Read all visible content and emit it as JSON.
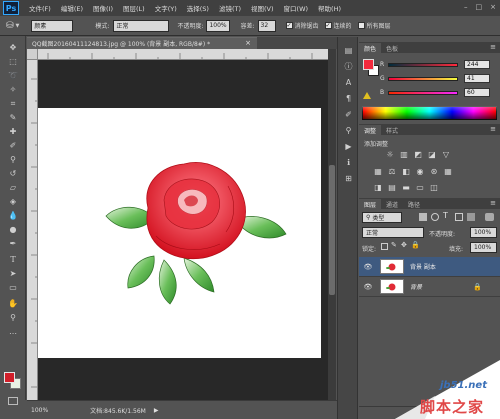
{
  "app": {
    "logo": "Ps"
  },
  "menubar": {
    "items": [
      "文件(F)",
      "编辑(E)",
      "图像(I)",
      "图层(L)",
      "文字(Y)",
      "选择(S)",
      "滤镜(T)",
      "视图(V)",
      "窗口(W)",
      "帮助(H)"
    ],
    "window_controls": [
      "–",
      "□",
      "×"
    ]
  },
  "options": {
    "brush_mode_label": "模式:",
    "preset_value": "颜素",
    "mode_value": "正常",
    "opacity_label": "不透明度:",
    "opacity_value": "100%",
    "tolerance_label": "容差:",
    "tolerance_value": "32",
    "antialias_label": "消除锯齿",
    "contiguous_label": "连续的",
    "all_layers_label": "所有图层"
  },
  "document": {
    "tab_title": "QQ截图20160411124813.jpg @ 100% (背景 副本, RGB/8#) *",
    "close_glyph": "×"
  },
  "status": {
    "zoom": "100%",
    "doc_size": "文档:845.6K/1.56M"
  },
  "color_panel": {
    "tabs": [
      "颜色",
      "色板"
    ],
    "r_label": "R",
    "r_value": "244",
    "g_label": "G",
    "g_value": "41",
    "b_label": "B",
    "b_value": "60",
    "foreground": "#f4293c",
    "background": "#ffffff"
  },
  "adjustments_panel": {
    "tabs": [
      "调整",
      "样式"
    ],
    "title": "添加调整"
  },
  "layers_panel": {
    "tabs": [
      "图层",
      "通道",
      "路径"
    ],
    "kind_filter": "类型",
    "blend_mode": "正常",
    "opacity_label": "不透明度:",
    "opacity_value": "100%",
    "lock_label": "锁定:",
    "fill_label": "填充:",
    "fill_value": "100%",
    "layers": [
      {
        "name": "背景 副本",
        "selected": true
      },
      {
        "name": "背景",
        "selected": false
      }
    ]
  },
  "watermark": {
    "site": "jb51.net",
    "text": "脚本之家"
  }
}
